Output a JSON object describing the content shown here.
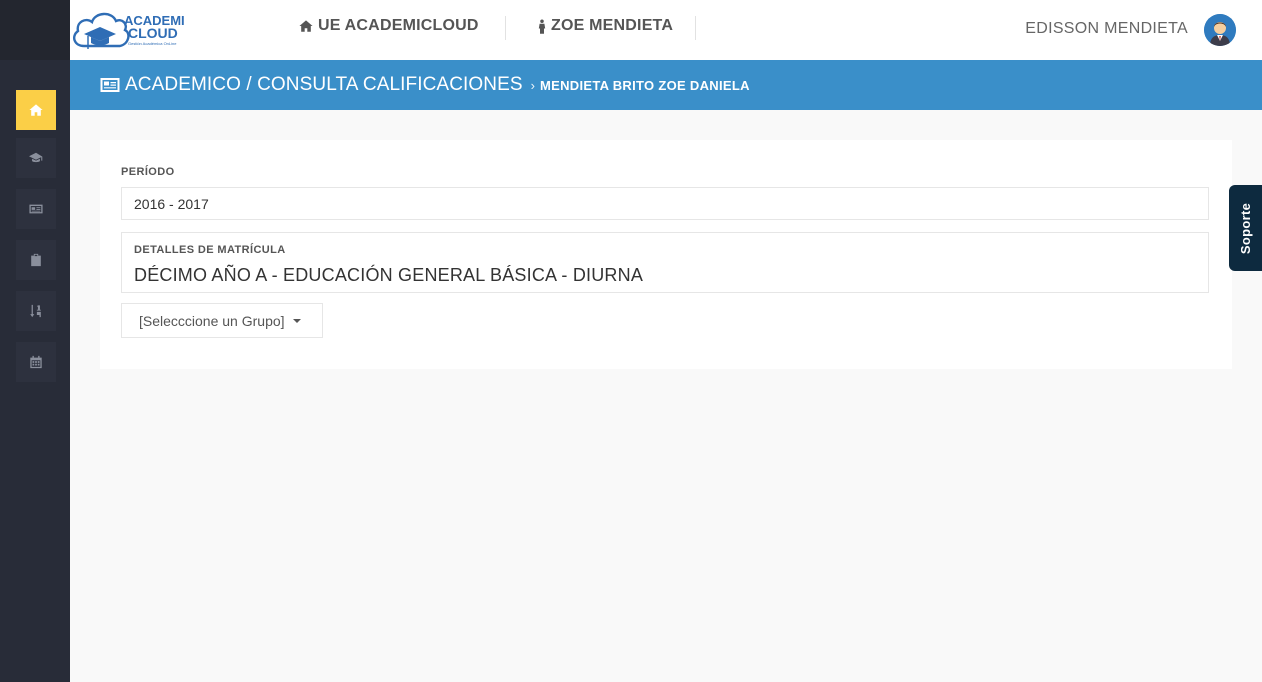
{
  "header": {
    "logo_text_top": "ACADEMI",
    "logo_text_bottom": "CLOUD",
    "logo_tagline": "Gestión Académica OnLine",
    "nav": [
      {
        "label": "UE ACADEMICLOUD",
        "icon": "home-icon"
      },
      {
        "label": "ZOE MENDIETA",
        "icon": "person-icon"
      }
    ],
    "user_name": "EDISSON MENDIETA"
  },
  "sidebar": {
    "items": [
      {
        "icon": "home-icon",
        "active": true
      },
      {
        "icon": "graduation-cap-icon",
        "active": false
      },
      {
        "icon": "id-card-icon",
        "active": false
      },
      {
        "icon": "clipboard-icon",
        "active": false
      },
      {
        "icon": "sort-numeric-icon",
        "active": false
      },
      {
        "icon": "calendar-icon",
        "active": false
      }
    ]
  },
  "titlebar": {
    "title": "ACADEMICO / CONSULTA CALIFICACIONES",
    "separator": "›",
    "student": "MENDIETA BRITO ZOE DANIELA"
  },
  "form": {
    "periodo_label": "PERÍODO",
    "periodo_value": "2016 - 2017",
    "detalle_label": "DETALLES DE MATRÍCULA",
    "detalle_value": "DÉCIMO AÑO A - EDUCACIÓN GENERAL BÁSICA - DIURNA",
    "group_select": "[Selecccione un Grupo]"
  },
  "support_tab": "Soporte",
  "colors": {
    "sidebar": "#282c38",
    "active": "#fbcf47",
    "titlebar": "#3a8fc9",
    "support": "#0d2a3f"
  }
}
